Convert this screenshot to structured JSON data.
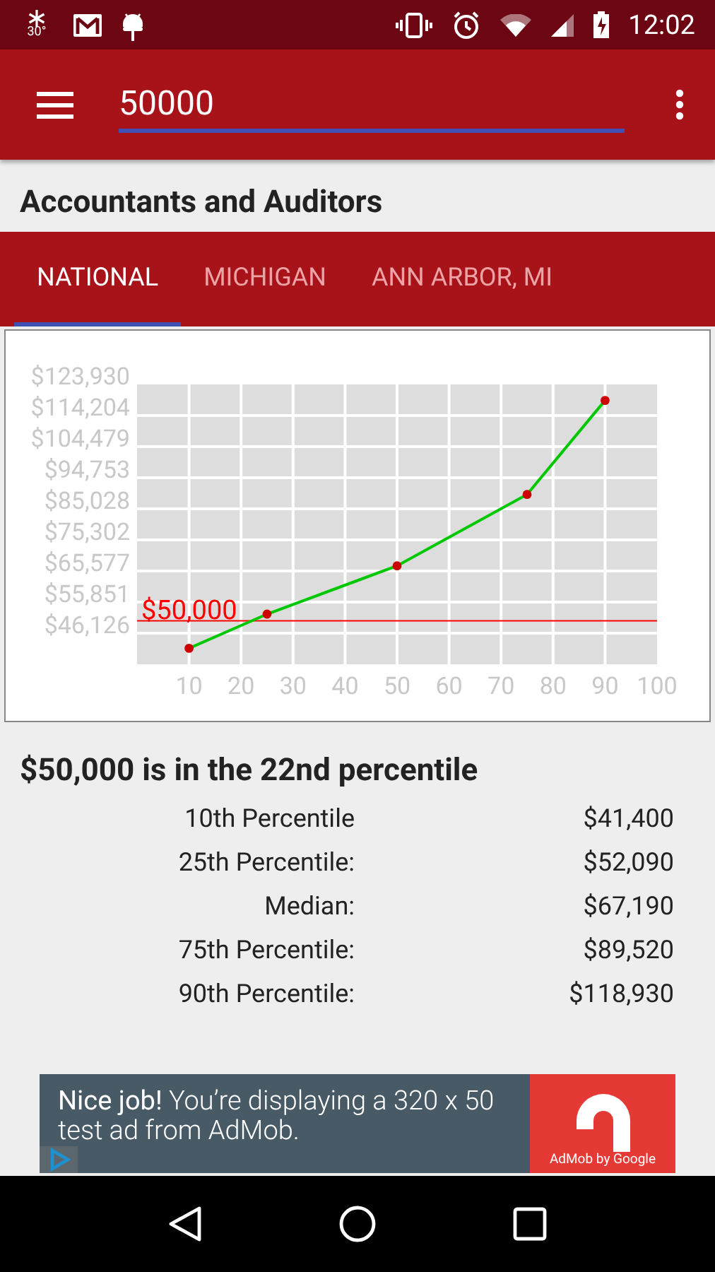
{
  "status_bar": {
    "temperature": "30°",
    "time": "12:02"
  },
  "toolbar": {
    "search": {
      "value": "50000"
    }
  },
  "title": "Accountants and Auditors",
  "tabs": [
    {
      "label": "NATIONAL",
      "selected": true
    },
    {
      "label": "MICHIGAN",
      "selected": false
    },
    {
      "label": "ANN ARBOR, MI",
      "selected": false
    }
  ],
  "chart": {
    "chart_data": {
      "type": "line",
      "x": [
        10,
        25,
        50,
        75,
        90
      ],
      "grid": true,
      "series": [
        {
          "color": "#00c800",
          "marker": "o",
          "values": [
            41400,
            52090,
            67190,
            89520,
            118930
          ]
        }
      ],
      "xlim": [
        0,
        100
      ],
      "ylim": [
        36400,
        123930
      ],
      "xticks": [
        10,
        20,
        30,
        40,
        50,
        60,
        70,
        80,
        90,
        100
      ],
      "yticks": [
        {
          "value": 46126,
          "label": "$46,126"
        },
        {
          "value": 55851,
          "label": "$55,851"
        },
        {
          "value": 65577,
          "label": "$65,577"
        },
        {
          "value": 75302,
          "label": "$75,302"
        },
        {
          "value": 85028,
          "label": "$85,028"
        },
        {
          "value": 94753,
          "label": "$94,753"
        },
        {
          "value": 104479,
          "label": "$104,479"
        },
        {
          "value": 114204,
          "label": "$114,204"
        },
        {
          "value": 123930,
          "label": "$123,930"
        }
      ],
      "ref_lines": [
        {
          "axis": "y",
          "value": 50000,
          "label": "$50,000",
          "color": "#ff0000"
        }
      ]
    }
  },
  "result": "$50,000 is in the 22nd percentile",
  "percentiles": [
    {
      "label": "10th Percentile",
      "value": "$41,400"
    },
    {
      "label": "25th Percentile:",
      "value": "$52,090"
    },
    {
      "label": "Median:",
      "value": "$67,190"
    },
    {
      "label": "75th Percentile:",
      "value": "$89,520"
    },
    {
      "label": "90th Percentile:",
      "value": "$118,930"
    }
  ],
  "ad": {
    "text": "**Nice job!** You’re displaying a 320 x 50 test ad from AdMob.",
    "brand": "AdMob by Google"
  }
}
